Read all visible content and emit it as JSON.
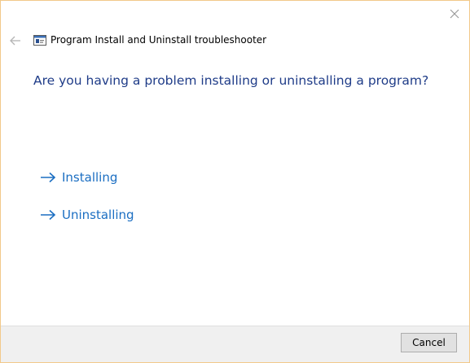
{
  "window": {
    "title": "Program Install and Uninstall troubleshooter",
    "app_icon": "troubleshooter-icon",
    "close_icon": "close-icon",
    "back_icon": "back-arrow-icon"
  },
  "main": {
    "question": "Are you having a problem installing or uninstalling a program?",
    "options": [
      {
        "label": "Installing",
        "icon": "right-arrow-icon"
      },
      {
        "label": "Uninstalling",
        "icon": "right-arrow-icon"
      }
    ]
  },
  "footer": {
    "cancel_label": "Cancel"
  },
  "colors": {
    "question_text": "#1f3c88",
    "link_text": "#1b6ec2",
    "window_border": "#f2c98a",
    "footer_bg": "#f0f0f0"
  }
}
